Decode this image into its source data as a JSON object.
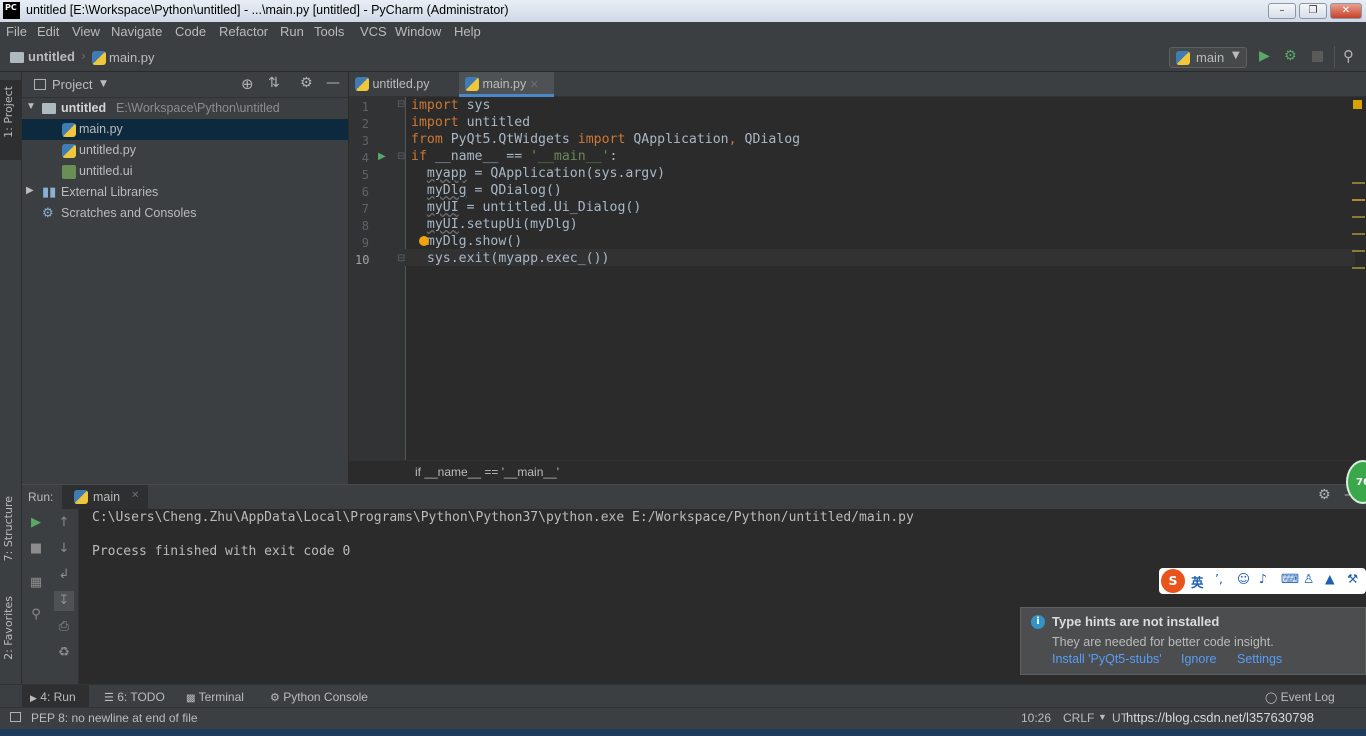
{
  "window": {
    "title": "untitled [E:\\Workspace\\Python\\untitled] - ...\\main.py [untitled] - PyCharm (Administrator)",
    "logo_text": "PC"
  },
  "menu": [
    "File",
    "Edit",
    "View",
    "Navigate",
    "Code",
    "Refactor",
    "Run",
    "Tools",
    "VCS",
    "Window",
    "Help"
  ],
  "navbar": {
    "project": "untitled",
    "file": "main.py",
    "run_config": "main"
  },
  "left_stripe": {
    "project_tab": "1: Project",
    "structure_tab": "7: Structure",
    "favorites_tab": "2: Favorites"
  },
  "project_panel": {
    "header": "Project",
    "tree": [
      {
        "label": "untitled",
        "path": "E:\\Workspace\\Python\\untitled"
      },
      {
        "label": "main.py"
      },
      {
        "label": "untitled.py"
      },
      {
        "label": "untitled.ui"
      },
      {
        "label": "External Libraries"
      },
      {
        "label": "Scratches and Consoles"
      }
    ]
  },
  "editor": {
    "tabs": [
      "untitled.py",
      "main.py"
    ],
    "line_numbers": [
      "1",
      "2",
      "3",
      "4",
      "5",
      "6",
      "7",
      "8",
      "9",
      "10"
    ],
    "breadcrumb": "if __name__ == '__main__'"
  },
  "run_panel": {
    "label": "Run:",
    "tab": "main",
    "output_line1": "C:\\Users\\Cheng.Zhu\\AppData\\Local\\Programs\\Python\\Python37\\python.exe E:/Workspace/Python/untitled/main.py",
    "output_line2": "Process finished with exit code 0"
  },
  "bottom_tabs": {
    "run": "4: Run",
    "todo": "6: TODO",
    "terminal": "Terminal",
    "console": "Python Console",
    "event_log": "Event Log"
  },
  "notification": {
    "title": "Type hints are not installed",
    "body": "They are needed for better code insight.",
    "install": "Install 'PyQt5-stubs'",
    "ignore": "Ignore",
    "settings": "Settings"
  },
  "status": {
    "message": "PEP 8: no newline at end of file",
    "position": "10:26",
    "line_sep": "CRLF",
    "encoding": "UT",
    "watermark": "https://blog.csdn.net/l357630798"
  },
  "ime": {
    "lang": "英"
  },
  "badge": {
    "value": "76"
  }
}
